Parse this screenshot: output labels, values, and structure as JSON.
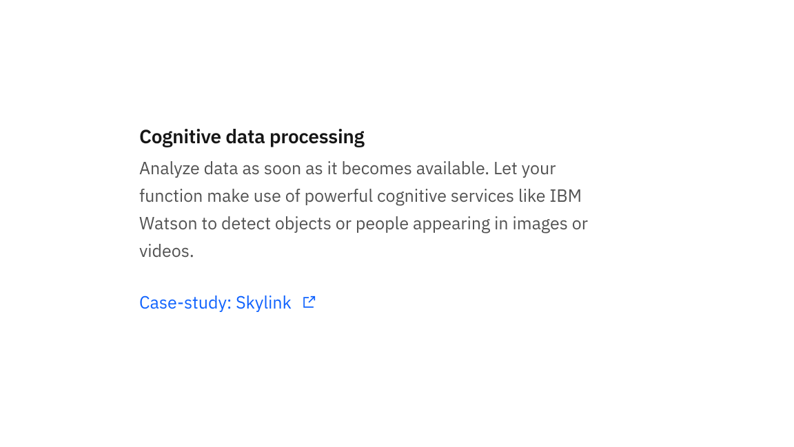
{
  "section": {
    "heading": "Cognitive data processing",
    "description": "Analyze data as soon as it becomes available. Let your function make use of powerful cognitive services like IBM Watson to detect objects or people appearing in images or videos.",
    "link_label": "Case-study: Skylink"
  },
  "colors": {
    "text_primary": "#161616",
    "text_secondary": "#525252",
    "link": "#0f62fe",
    "background": "#ffffff"
  }
}
